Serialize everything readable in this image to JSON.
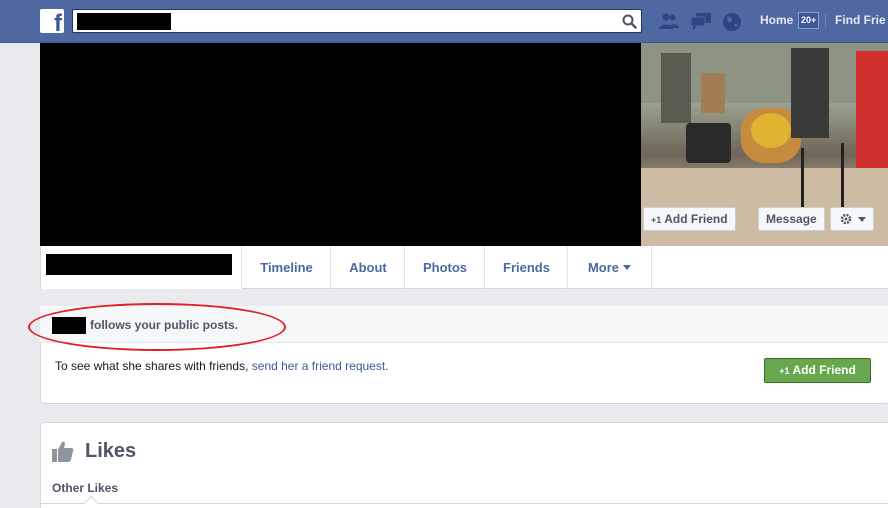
{
  "topbar": {
    "logo": "f",
    "nav": {
      "home": "Home",
      "home_badge": "20+",
      "find_friends": "Find Frie"
    },
    "icons": [
      "friend-requests-icon",
      "messages-icon",
      "notifications-globe-icon",
      "search-icon"
    ]
  },
  "cover": {
    "add_friend_label": "Add Friend",
    "add_friend_plus": "+1",
    "message_label": "Message"
  },
  "tabs": [
    {
      "label": "Timeline"
    },
    {
      "label": "About"
    },
    {
      "label": "Photos"
    },
    {
      "label": "Friends"
    },
    {
      "label": "More"
    }
  ],
  "follow_card": {
    "follow_text": "follows your public posts.",
    "see_text": "To see what she shares with friends, ",
    "see_link": "send her a friend request.",
    "add_friend_label": "Add Friend",
    "add_friend_plus": "+1"
  },
  "likes": {
    "title": "Likes",
    "subtitle": "Other Likes"
  },
  "colors": {
    "topbar": "#4e69a2",
    "link": "#3b5998",
    "green_button": "#69a74e",
    "annotation": "#e01f26"
  }
}
